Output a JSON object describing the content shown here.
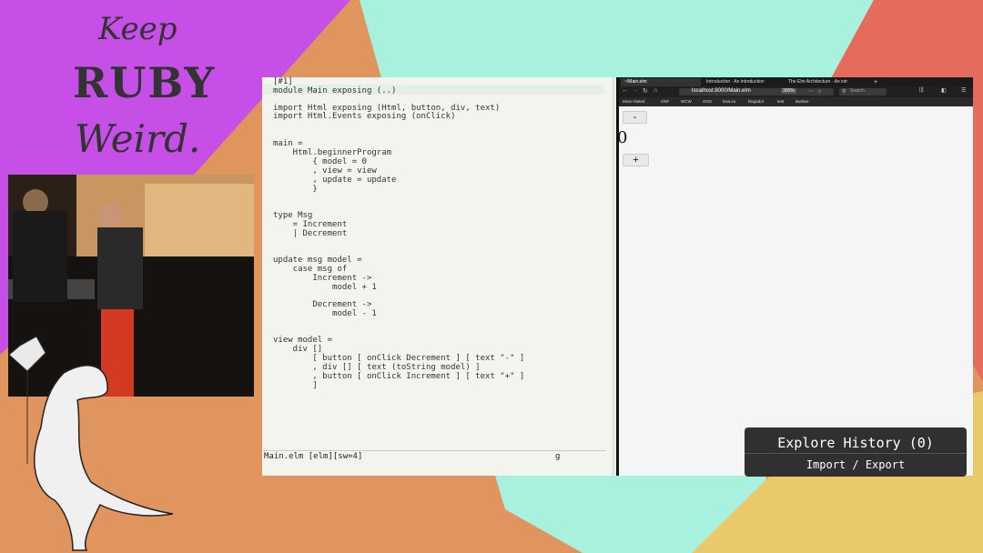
{
  "branding": {
    "line1": "Keep",
    "line2": "RUBY",
    "line3": "Weird."
  },
  "editor": {
    "lines": [
      "[#1]",
      "module Main exposing (..)",
      "",
      "import Html exposing (Html, button, div, text)",
      "import Html.Events exposing (onClick)",
      "",
      "",
      "main =",
      "    Html.beginnerProgram",
      "        { model = 0",
      "        , view = view",
      "        , update = update",
      "        }",
      "",
      "",
      "type Msg",
      "    = Increment",
      "    | Decrement",
      "",
      "",
      "update msg model =",
      "    case msg of",
      "        Increment ->",
      "            model + 1",
      "",
      "        Decrement ->",
      "            model - 1",
      "",
      "",
      "view model =",
      "    div []",
      "        [ button [ onClick Decrement ] [ text \"-\" ]",
      "        , div [] [ text (toString model) ]",
      "        , button [ onClick Increment ] [ text \"+\" ]",
      "        ]"
    ],
    "status_file": "Main.elm [elm][sw=4]",
    "status_right": "g"
  },
  "browser": {
    "tabs": [
      "~/Main.elm",
      "Introduction · An introduction",
      "The Elm Architecture · An intr"
    ],
    "url": "localhost:8000/Main.elm",
    "zoom": "300%",
    "search_placeholder": "Search",
    "bookmarks": [
      "Most Visited",
      "OSF",
      "WCW",
      "OOS",
      "bnw.ca",
      "blogsdot",
      "test",
      "lawfare"
    ],
    "decrement_label": "-",
    "model_value": "0",
    "increment_label": "+"
  },
  "history": {
    "title": "Explore History (0)",
    "actions": "Import / Export"
  },
  "colors": {
    "purple": "#c64fe8",
    "mint": "#a8f1df",
    "coral": "#e56b5c",
    "orange": "#e0955e",
    "yellow": "#eac96b"
  }
}
